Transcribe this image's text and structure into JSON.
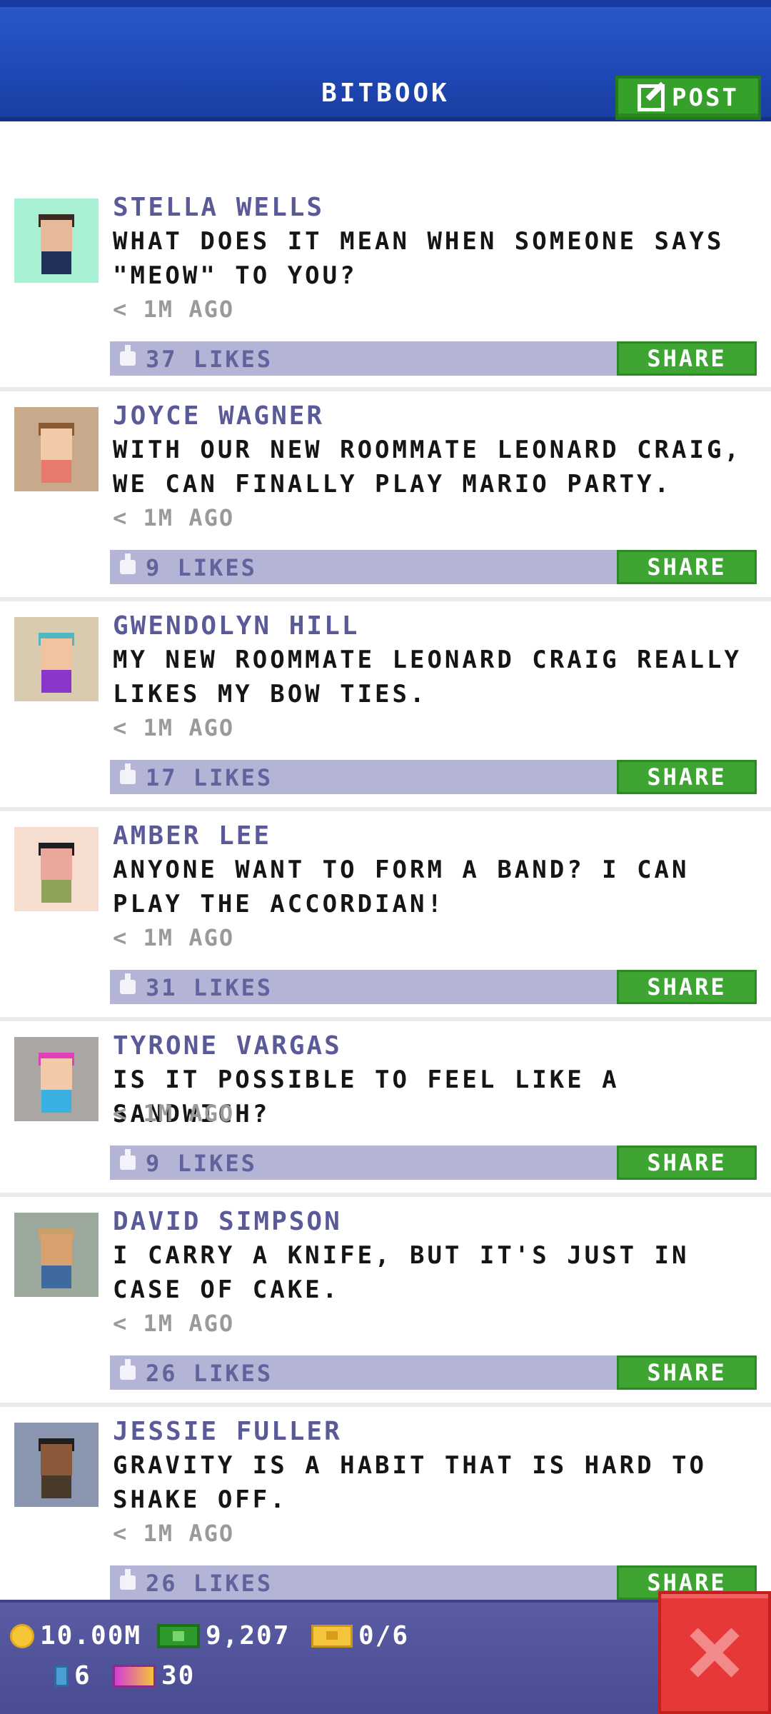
{
  "header": {
    "title": "BITBOOK",
    "post_label": "POST"
  },
  "posts": [
    {
      "author": "STELLA WELLS",
      "message": "WHAT DOES IT MEAN WHEN SOMEONE SAYS \"MEOW\" TO YOU?",
      "time": "< 1M AGO",
      "likes": "37 LIKES",
      "share": "SHARE",
      "avatar_bg": "#a8f0d3"
    },
    {
      "author": "JOYCE WAGNER",
      "message": "WITH OUR NEW ROOMMATE LEONARD CRAIG, WE CAN FINALLY PLAY MARIO PARTY.",
      "time": "< 1M AGO",
      "likes": "9 LIKES",
      "share": "SHARE",
      "avatar_bg": "#c9a98c"
    },
    {
      "author": "GWENDOLYN HILL",
      "message": "MY NEW ROOMMATE LEONARD CRAIG REALLY LIKES MY BOW TIES.",
      "time": "< 1M AGO",
      "likes": "17 LIKES",
      "share": "SHARE",
      "avatar_bg": "#d8cbb0"
    },
    {
      "author": "AMBER LEE",
      "message": "ANYONE WANT TO FORM A BAND? I CAN PLAY THE ACCORDIAN!",
      "time": "< 1M AGO",
      "likes": "31 LIKES",
      "share": "SHARE",
      "avatar_bg": "#f5ddd0"
    },
    {
      "author": "TYRONE VARGAS",
      "message": "IS IT POSSIBLE TO FEEL LIKE A SANDWICH?",
      "time": "< 1M AGO",
      "likes": "9 LIKES",
      "share": "SHARE",
      "avatar_bg": "#aaa6a3"
    },
    {
      "author": "DAVID SIMPSON",
      "message": "I CARRY A KNIFE, BUT IT'S JUST IN CASE OF CAKE.",
      "time": "< 1M AGO",
      "likes": "26 LIKES",
      "share": "SHARE",
      "avatar_bg": "#9aa99c"
    },
    {
      "author": "JESSIE FULLER",
      "message": "GRAVITY IS A HABIT THAT IS HARD TO SHAKE OFF.",
      "time": "< 1M AGO",
      "likes": "26 LIKES",
      "share": "SHARE",
      "avatar_bg": "#8a95b0"
    }
  ],
  "status_bar": {
    "coins": "10.00M",
    "bux": "9,207",
    "tickets": "0/6",
    "tokens": "6",
    "vip": "30"
  },
  "colors": {
    "header_blue": "#1f49b6",
    "share_green": "#3ea533",
    "close_red": "#e63838"
  }
}
